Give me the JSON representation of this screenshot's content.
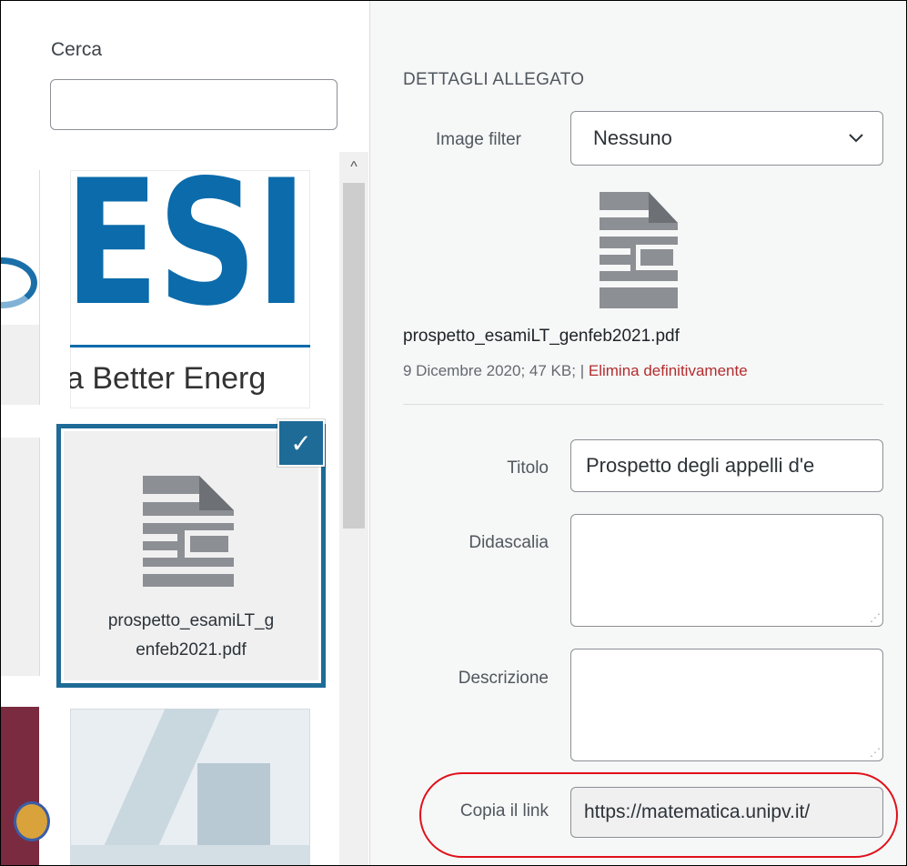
{
  "search": {
    "label": "Cerca",
    "value": "",
    "placeholder": ""
  },
  "library": {
    "items": [
      {
        "logo_text": "ESI",
        "tagline": "a Better Energ"
      },
      {
        "file_name": "prospetto_esamiLT_g enfeb2021.pdf",
        "selected": true,
        "icon": "document-icon",
        "check_icon": "checkmark-icon"
      },
      {
        "kind": "image-thumbnail"
      }
    ],
    "scroll_up_glyph": "^"
  },
  "details": {
    "heading": "DETTAGLI ALLEGATO",
    "image_filter": {
      "label": "Image filter",
      "selected": "Nessuno",
      "chevron_icon": "chevron-down-icon"
    },
    "preview_icon": "document-icon",
    "file_name": "prospetto_esamiLT_genfeb2021.pdf",
    "uploaded": "9 Dicembre 2020;",
    "size": "47 KB;",
    "separator": "|",
    "delete_label": "Elimina definitivamente",
    "fields": {
      "title_label": "Titolo",
      "title_value": "Prospetto degli appelli d'e",
      "caption_label": "Didascalia",
      "caption_value": "",
      "description_label": "Descrizione",
      "description_value": "",
      "copy_link_label": "Copia il link",
      "copy_link_value": "https://matematica.unipv.it/"
    }
  },
  "colors": {
    "accent": "#1e6b97",
    "delete": "#b32d2e",
    "highlight": "#e0101a",
    "esi_blue": "#0b6bab"
  }
}
